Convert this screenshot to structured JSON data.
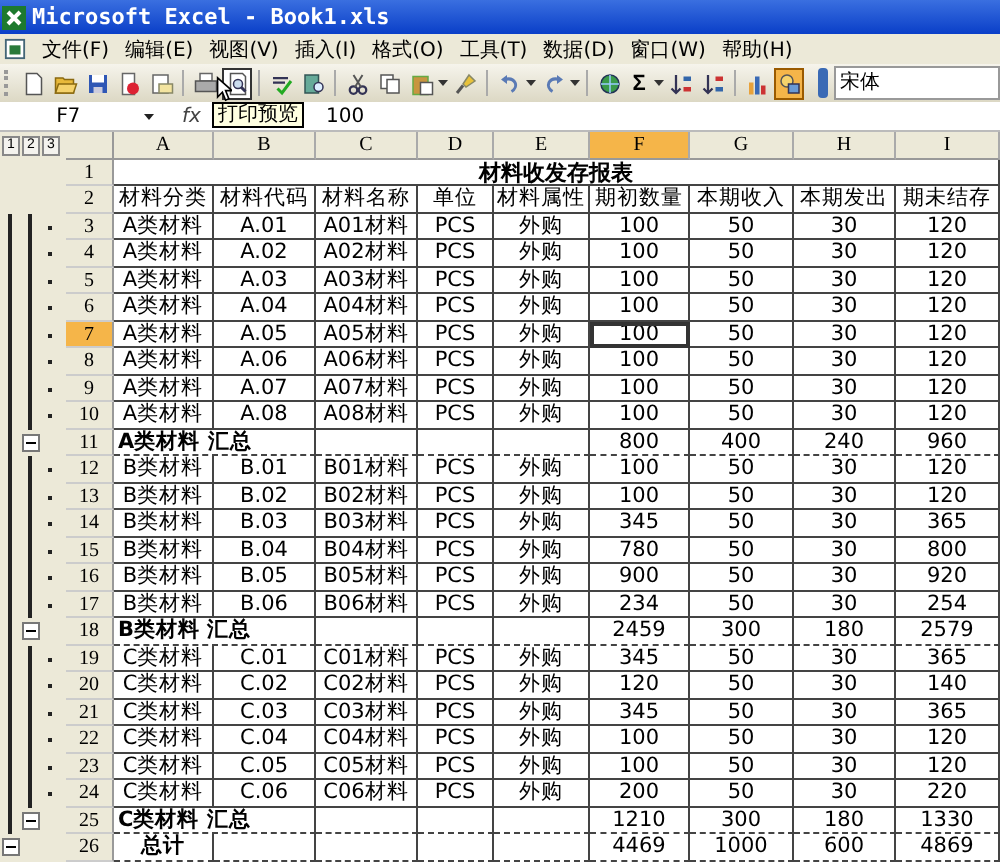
{
  "window": {
    "title": "Microsoft Excel - Book1.xls"
  },
  "menu": [
    "文件(F)",
    "编辑(E)",
    "视图(V)",
    "插入(I)",
    "格式(O)",
    "工具(T)",
    "数据(D)",
    "窗口(W)",
    "帮助(H)"
  ],
  "toolbar": [
    [
      {
        "kind": "new",
        "hover": false,
        "pressed": false,
        "dropdown": false
      },
      {
        "kind": "open",
        "hover": false,
        "pressed": false,
        "dropdown": false
      },
      {
        "kind": "save",
        "hover": false,
        "pressed": false,
        "dropdown": false
      },
      {
        "kind": "permission",
        "hover": false,
        "pressed": false,
        "dropdown": false
      },
      {
        "kind": "mail",
        "hover": false,
        "pressed": false,
        "dropdown": false
      }
    ],
    [
      {
        "kind": "print",
        "hover": false,
        "pressed": false,
        "dropdown": false
      },
      {
        "kind": "preview",
        "hover": true,
        "pressed": false,
        "dropdown": false
      }
    ],
    [
      {
        "kind": "spell",
        "hover": false,
        "pressed": false,
        "dropdown": false
      },
      {
        "kind": "research",
        "hover": false,
        "pressed": false,
        "dropdown": false
      }
    ],
    [
      {
        "kind": "cut",
        "hover": false,
        "pressed": false,
        "dropdown": false
      },
      {
        "kind": "copy",
        "hover": false,
        "pressed": false,
        "dropdown": false
      },
      {
        "kind": "paste",
        "hover": false,
        "pressed": false,
        "dropdown": true
      },
      {
        "kind": "painter",
        "hover": false,
        "pressed": false,
        "dropdown": false
      }
    ],
    [
      {
        "kind": "undo",
        "hover": false,
        "pressed": false,
        "dropdown": true
      },
      {
        "kind": "redo",
        "hover": false,
        "pressed": false,
        "dropdown": true
      }
    ],
    [
      {
        "kind": "link",
        "hover": false,
        "pressed": false,
        "dropdown": false
      },
      {
        "kind": "sum",
        "text": "Σ",
        "hover": false,
        "pressed": false,
        "dropdown": true
      },
      {
        "kind": "sortasc",
        "hover": false,
        "pressed": false,
        "dropdown": false
      },
      {
        "kind": "sortdesc",
        "hover": false,
        "pressed": false,
        "dropdown": false
      }
    ],
    [
      {
        "kind": "chart",
        "hover": false,
        "pressed": false,
        "dropdown": false
      },
      {
        "kind": "drawing",
        "hover": false,
        "pressed": true,
        "dropdown": false
      }
    ]
  ],
  "font_box": {
    "value": "宋体"
  },
  "tooltip": "打印预览",
  "formula_bar": {
    "name_box": "F7",
    "fx": "fx",
    "value": "100"
  },
  "outline_levels": [
    "1",
    "2",
    "3"
  ],
  "columns": [
    {
      "label": "A",
      "selected": false
    },
    {
      "label": "B",
      "selected": false
    },
    {
      "label": "C",
      "selected": false
    },
    {
      "label": "D",
      "selected": false
    },
    {
      "label": "E",
      "selected": false
    },
    {
      "label": "F",
      "selected": true
    },
    {
      "label": "G",
      "selected": false
    },
    {
      "label": "H",
      "selected": false
    },
    {
      "label": "I",
      "selected": false
    }
  ],
  "rows": [
    {
      "n": "1",
      "kind": "title",
      "text": "材料收发存报表",
      "selected": false
    },
    {
      "n": "2",
      "kind": "header",
      "cells": [
        "材料分类",
        "材料代码",
        "材料名称",
        "单位",
        "材料属性",
        "期初数量",
        "本期收入",
        "本期发出",
        "期未结存"
      ],
      "selected": false
    },
    {
      "n": "3",
      "kind": "data",
      "cells": [
        "A类材料",
        "A.01",
        "A01材料",
        "PCS",
        "外购",
        "100",
        "50",
        "30",
        "120"
      ],
      "selected": false
    },
    {
      "n": "4",
      "kind": "data",
      "cells": [
        "A类材料",
        "A.02",
        "A02材料",
        "PCS",
        "外购",
        "100",
        "50",
        "30",
        "120"
      ],
      "selected": false
    },
    {
      "n": "5",
      "kind": "data",
      "cells": [
        "A类材料",
        "A.03",
        "A03材料",
        "PCS",
        "外购",
        "100",
        "50",
        "30",
        "120"
      ],
      "selected": false
    },
    {
      "n": "6",
      "kind": "data",
      "cells": [
        "A类材料",
        "A.04",
        "A04材料",
        "PCS",
        "外购",
        "100",
        "50",
        "30",
        "120"
      ],
      "selected": false
    },
    {
      "n": "7",
      "kind": "data",
      "cells": [
        "A类材料",
        "A.05",
        "A05材料",
        "PCS",
        "外购",
        "100",
        "50",
        "30",
        "120"
      ],
      "selected": true
    },
    {
      "n": "8",
      "kind": "data",
      "cells": [
        "A类材料",
        "A.06",
        "A06材料",
        "PCS",
        "外购",
        "100",
        "50",
        "30",
        "120"
      ],
      "selected": false
    },
    {
      "n": "9",
      "kind": "data",
      "cells": [
        "A类材料",
        "A.07",
        "A07材料",
        "PCS",
        "外购",
        "100",
        "50",
        "30",
        "120"
      ],
      "selected": false
    },
    {
      "n": "10",
      "kind": "data",
      "cells": [
        "A类材料",
        "A.08",
        "A08材料",
        "PCS",
        "外购",
        "100",
        "50",
        "30",
        "120"
      ],
      "selected": false
    },
    {
      "n": "11",
      "kind": "subtotal",
      "label": "A类材料 汇总",
      "values": [
        "800",
        "400",
        "240",
        "960"
      ],
      "selected": false
    },
    {
      "n": "12",
      "kind": "data",
      "cells": [
        "B类材料",
        "B.01",
        "B01材料",
        "PCS",
        "外购",
        "100",
        "50",
        "30",
        "120"
      ],
      "selected": false
    },
    {
      "n": "13",
      "kind": "data",
      "cells": [
        "B类材料",
        "B.02",
        "B02材料",
        "PCS",
        "外购",
        "100",
        "50",
        "30",
        "120"
      ],
      "selected": false
    },
    {
      "n": "14",
      "kind": "data",
      "cells": [
        "B类材料",
        "B.03",
        "B03材料",
        "PCS",
        "外购",
        "345",
        "50",
        "30",
        "365"
      ],
      "selected": false
    },
    {
      "n": "15",
      "kind": "data",
      "cells": [
        "B类材料",
        "B.04",
        "B04材料",
        "PCS",
        "外购",
        "780",
        "50",
        "30",
        "800"
      ],
      "selected": false
    },
    {
      "n": "16",
      "kind": "data",
      "cells": [
        "B类材料",
        "B.05",
        "B05材料",
        "PCS",
        "外购",
        "900",
        "50",
        "30",
        "920"
      ],
      "selected": false
    },
    {
      "n": "17",
      "kind": "data",
      "cells": [
        "B类材料",
        "B.06",
        "B06材料",
        "PCS",
        "外购",
        "234",
        "50",
        "30",
        "254"
      ],
      "selected": false
    },
    {
      "n": "18",
      "kind": "subtotal",
      "label": "B类材料 汇总",
      "values": [
        "2459",
        "300",
        "180",
        "2579"
      ],
      "selected": false
    },
    {
      "n": "19",
      "kind": "data",
      "cells": [
        "C类材料",
        "C.01",
        "C01材料",
        "PCS",
        "外购",
        "345",
        "50",
        "30",
        "365"
      ],
      "selected": false
    },
    {
      "n": "20",
      "kind": "data",
      "cells": [
        "C类材料",
        "C.02",
        "C02材料",
        "PCS",
        "外购",
        "120",
        "50",
        "30",
        "140"
      ],
      "selected": false
    },
    {
      "n": "21",
      "kind": "data",
      "cells": [
        "C类材料",
        "C.03",
        "C03材料",
        "PCS",
        "外购",
        "345",
        "50",
        "30",
        "365"
      ],
      "selected": false
    },
    {
      "n": "22",
      "kind": "data",
      "cells": [
        "C类材料",
        "C.04",
        "C04材料",
        "PCS",
        "外购",
        "100",
        "50",
        "30",
        "120"
      ],
      "selected": false
    },
    {
      "n": "23",
      "kind": "data",
      "cells": [
        "C类材料",
        "C.05",
        "C05材料",
        "PCS",
        "外购",
        "100",
        "50",
        "30",
        "120"
      ],
      "selected": false
    },
    {
      "n": "24",
      "kind": "data",
      "cells": [
        "C类材料",
        "C.06",
        "C06材料",
        "PCS",
        "外购",
        "200",
        "50",
        "30",
        "220"
      ],
      "selected": false
    },
    {
      "n": "25",
      "kind": "subtotal",
      "label": "C类材料 汇总",
      "values": [
        "1210",
        "300",
        "180",
        "1330"
      ],
      "selected": false
    },
    {
      "n": "26",
      "kind": "total",
      "label": "总计",
      "values": [
        "4469",
        "1000",
        "600",
        "4869"
      ],
      "selected": false
    }
  ]
}
